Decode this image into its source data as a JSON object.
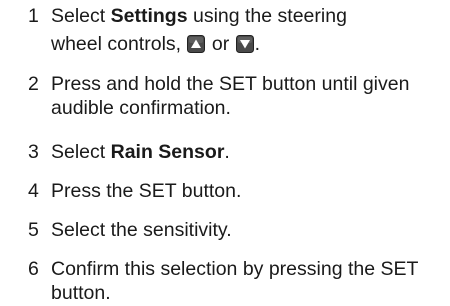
{
  "steps": [
    {
      "number": "1",
      "prefix": "Select ",
      "bold": "Settings",
      "middle": " using the steering",
      "line2_start": "wheel controls, ",
      "or_text": " or ",
      "end": ".",
      "icons": [
        "up-arrow-button-icon",
        "down-arrow-button-icon"
      ]
    },
    {
      "number": "2",
      "text": "Press and hold the SET button until given audible confirmation."
    },
    {
      "number": "3",
      "prefix": "Select ",
      "bold": "Rain Sensor",
      "end": "."
    },
    {
      "number": "4",
      "text": "Press the SET button."
    },
    {
      "number": "5",
      "text": "Select the sensitivity."
    },
    {
      "number": "6",
      "text": "Confirm this selection by pressing the SET button."
    }
  ],
  "colors": {
    "text": "#1a1a1a",
    "icon_fill": "#4a4a4a",
    "icon_highlight": "#9a9a9a"
  }
}
